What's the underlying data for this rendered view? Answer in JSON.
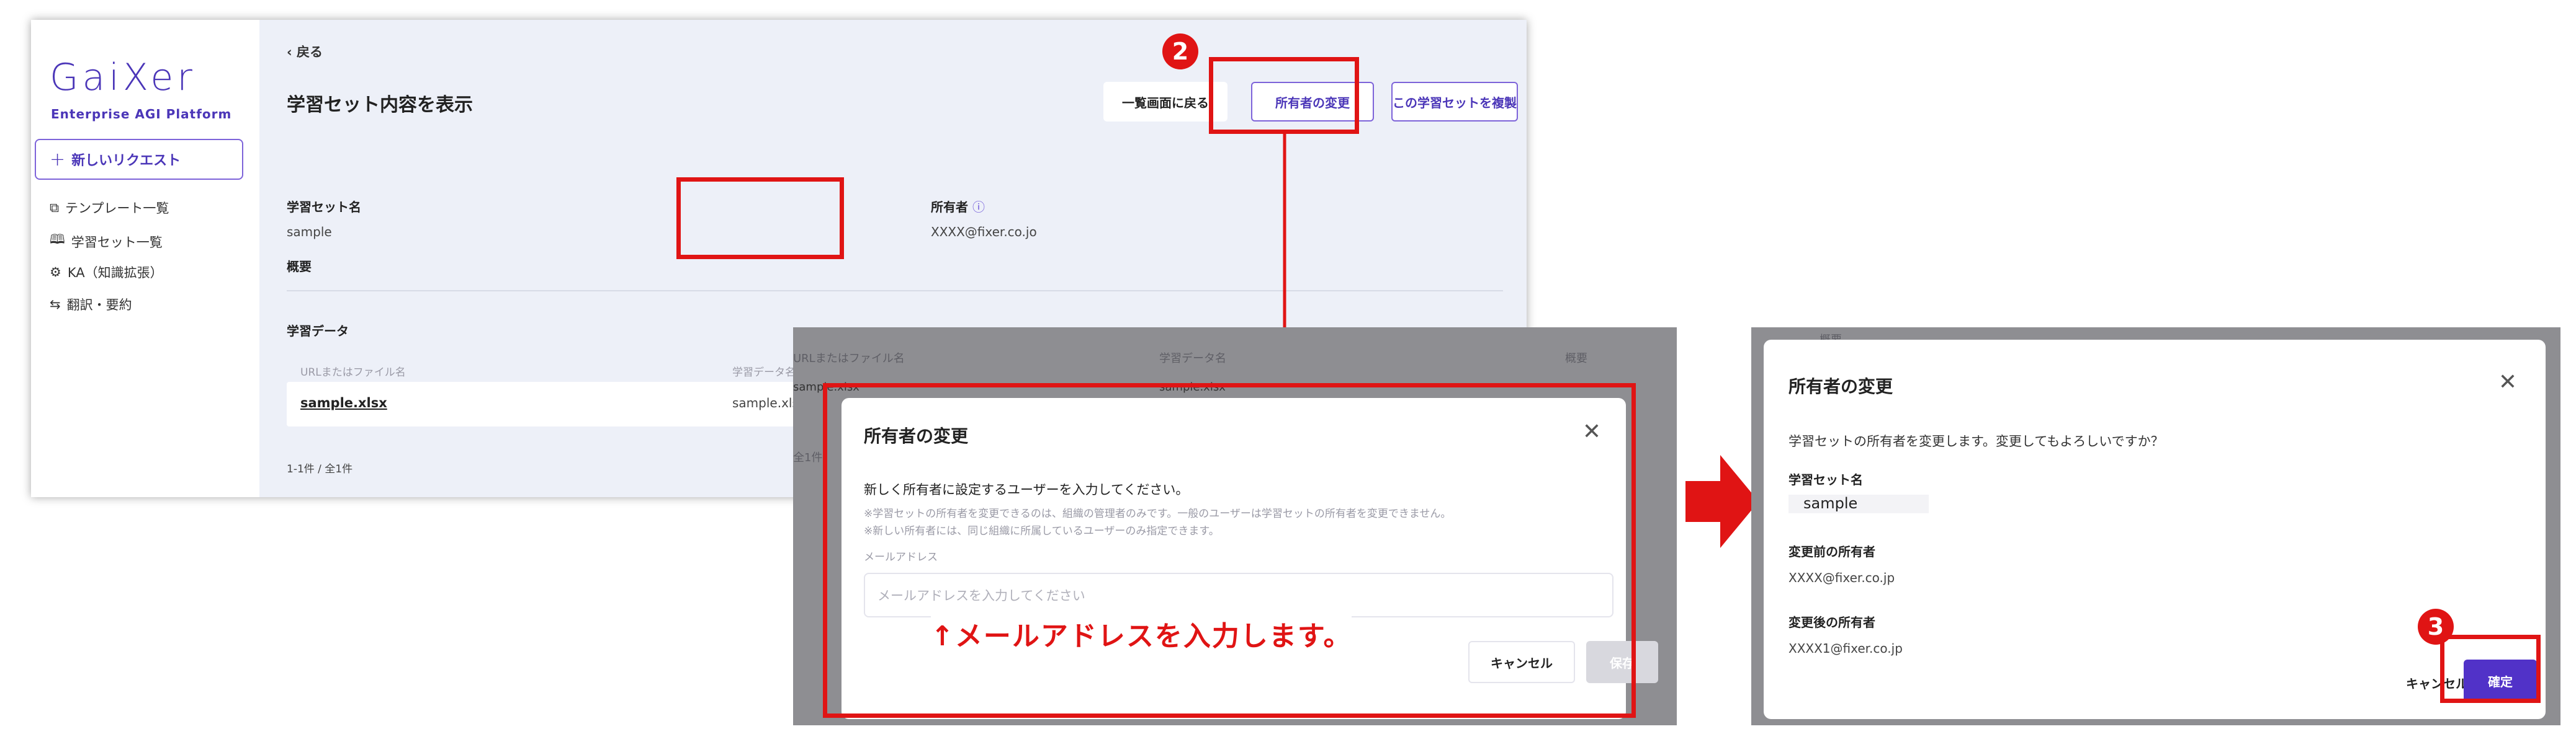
{
  "sidebar": {
    "logo": "GaiXer",
    "logo_sub": "Enterprise AGI Platform",
    "new_request": "新しいリクエスト",
    "items": [
      {
        "label": "テンプレート一覧"
      },
      {
        "label": "学習セット一覧"
      },
      {
        "label": "KA（知識拡張）"
      },
      {
        "label": "翻訳・要約"
      }
    ]
  },
  "main": {
    "back": "戻る",
    "title": "学習セット内容を表示",
    "btn_back_list": "一覧画面に戻る",
    "btn_change_owner": "所有者の変更",
    "btn_duplicate": "この学習セットを複製",
    "set_name_label": "学習セット名",
    "set_name_value": "sample",
    "summary_label": "概要",
    "owner_label": "所有者",
    "owner_value": "XXXX@fixer.co.jo",
    "data_label": "学習データ",
    "col_url": "URLまたはファイル名",
    "col_dataname": "学習データ名",
    "file_name": "sample.xlsx",
    "data_name": "sample.xlsx",
    "pagination": "1-1件 / 全1件"
  },
  "dialog_change": {
    "bg_col_file": "URLまたはファイル名",
    "bg_col_dataname": "学習データ名",
    "bg_col_summary": "概要",
    "bg_file": "sample.xlsx",
    "bg_data": "sample.xlsx",
    "bg_count": "全1件",
    "title": "所有者の変更",
    "instruction": "新しく所有者に設定するユーザーを入力してください。",
    "note1": "※学習セットの所有者を変更できるのは、組織の管理者のみです。一般のユーザーは学習セットの所有者を変更できません。",
    "note2": "※新しい所有者には、同じ組織に所属しているユーザーのみ指定できます。",
    "email_label": "メールアドレス",
    "email_placeholder": "メールアドレスを入力してください",
    "cancel": "キャンセル",
    "save": "保存",
    "annotation": "↑メールアドレスを入力します。"
  },
  "dialog_confirm": {
    "bg_text": "概要",
    "title": "所有者の変更",
    "message": "学習セットの所有者を変更します。変更してもよろしいですか？",
    "set_name_label": "学習セット名",
    "set_name_value": "sample",
    "before_label": "変更前の所有者",
    "before_value": "XXXX@fixer.co.jp",
    "after_label": "変更後の所有者",
    "after_value": "XXXX1@fixer.co.jp",
    "cancel": "キャンセル",
    "confirm": "確定"
  },
  "steps": {
    "step2": "2",
    "step3": "3"
  },
  "colors": {
    "accent": "#5132c8",
    "annotation_red": "#e01414",
    "brand": "#4b36b8"
  }
}
